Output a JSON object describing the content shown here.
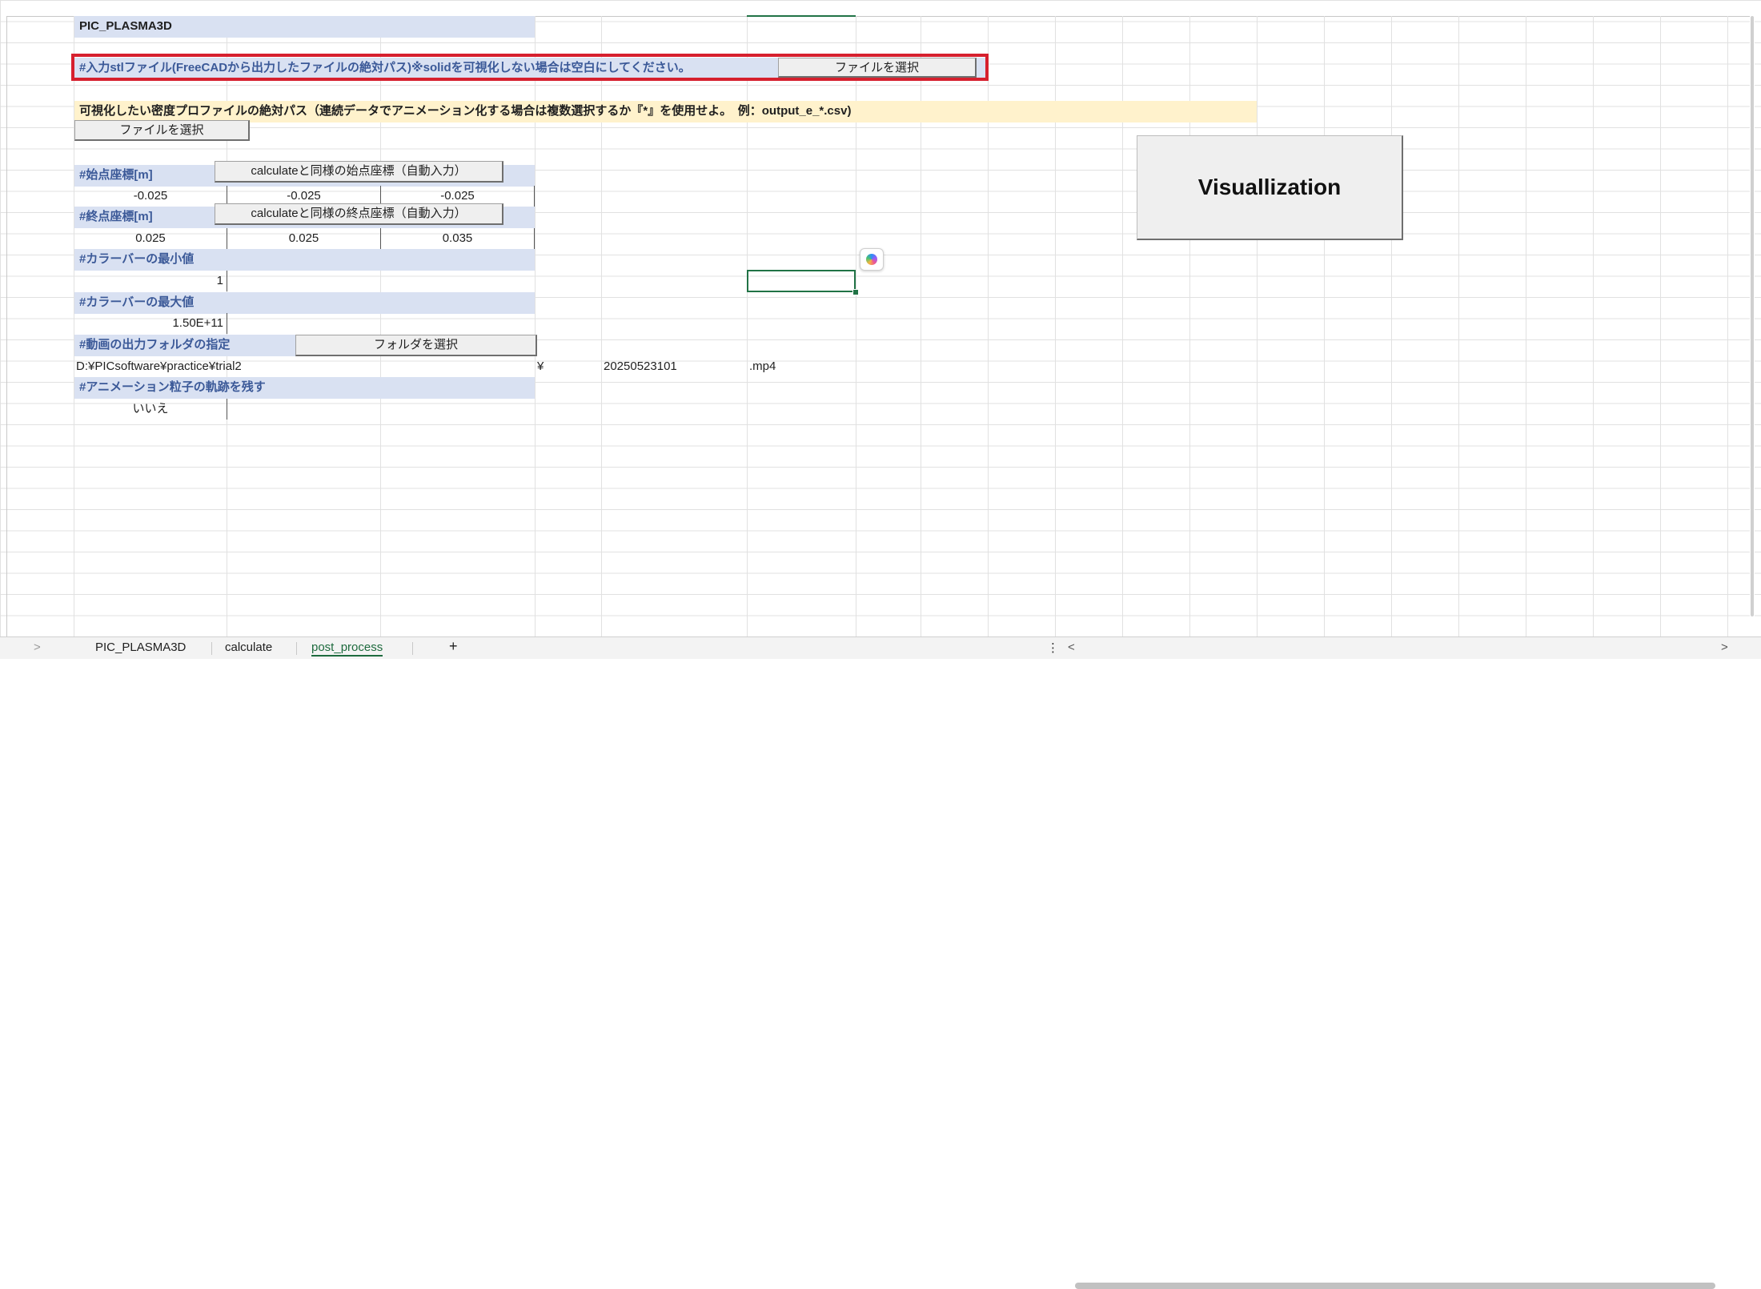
{
  "sheet": {
    "title_cell": "PIC_PLASMA3D",
    "stl_label": "#入力stlファイル(FreeCADから出力したファイルの絶対パス)※solidを可視化しない場合は空白にしてください。",
    "stl_button": "ファイルを選択",
    "density_label": "可視化したい密度プロファイルの絶対パス（連続データでアニメーション化する場合は複数選択するか『*』を使用せよ。　例：output_e_*.csv)",
    "density_button": "ファイルを選択",
    "start_label": "#始点座標[m]",
    "start_button": "calculateと同様の始点座標（自動入力）",
    "start_values": [
      "-0.025",
      "-0.025",
      "-0.025"
    ],
    "end_label": "#終点座標[m]",
    "end_button": "calculateと同様の終点座標（自動入力）",
    "end_values": [
      "0.025",
      "0.025",
      "0.035"
    ],
    "colorbar_min_label": "#カラーバーの最小値",
    "colorbar_min_value": "1",
    "colorbar_max_label": "#カラーバーの最大値",
    "colorbar_max_value": "1.50E+11",
    "output_folder_label": "#動画の出力フォルダの指定",
    "output_folder_button": "フォルダを選択",
    "output_path": "D:¥PICsoftware¥practice¥trial2",
    "yen": "¥",
    "file_stem": "20250523101",
    "ext": ".mp4",
    "trail_label": "#アニメーション粒子の軌跡を残す",
    "trail_value": "いいえ",
    "visualize_button": "Visuallization"
  },
  "tabs": {
    "items": [
      "PIC_PLASMA3D",
      "calculate",
      "post_process"
    ],
    "active": "post_process",
    "add": "+",
    "nav_prev": "<",
    "nav_next": ">",
    "more": "⋮"
  },
  "colors": {
    "header_fill": "#d9e1f2",
    "note_fill": "#fff2cc",
    "highlight_border": "#d6202e",
    "selection": "#217346"
  }
}
